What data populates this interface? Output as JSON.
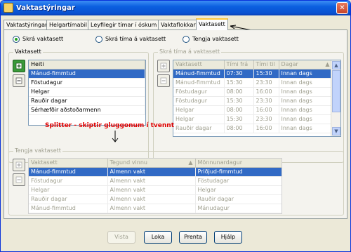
{
  "window": {
    "title": "Vaktastýringar"
  },
  "tabs": [
    {
      "label": "Vaktastýringar",
      "active": false
    },
    {
      "label": "Helgartímabil",
      "active": false
    },
    {
      "label": "Leyfilegir tímar í óskum",
      "active": false
    },
    {
      "label": "Vaktaflokkar",
      "active": false
    },
    {
      "label": "Vaktasett",
      "active": true
    }
  ],
  "radios": [
    {
      "label": "Skrá vaktasett",
      "checked": true
    },
    {
      "label": "Skrá tíma á vaktasett",
      "checked": false
    },
    {
      "label": "Tengja vaktasett",
      "checked": false
    }
  ],
  "vaktasett": {
    "legend": "Vaktasett",
    "header": "Heiti",
    "rows": [
      "Mánud-fimmtud",
      "Föstudagur",
      "Helgar",
      "Rauðir dagar",
      "Sérhæfðir aðstoðarmenn"
    ],
    "selected_index": 0
  },
  "timar": {
    "legend": "Skrá tíma á vaktasett",
    "columns": [
      "Vaktasett",
      "Tími frá",
      "Tími til",
      "Dagar"
    ],
    "rows": [
      [
        "Mánud-fimmtud",
        "07:30",
        "15:30",
        "Innan dags"
      ],
      [
        "Mánud-fimmtud",
        "15:30",
        "23:30",
        "Innan dags"
      ],
      [
        "Föstudagur",
        "08:00",
        "16:00",
        "Innan dags"
      ],
      [
        "Föstudagur",
        "15:30",
        "23:30",
        "Innan dags"
      ],
      [
        "Helgar",
        "08:00",
        "16:00",
        "Innan dags"
      ],
      [
        "Helgar",
        "15:30",
        "23:30",
        "Innan dags"
      ],
      [
        "Rauðir dagar",
        "08:00",
        "16:00",
        "Innan dags"
      ]
    ],
    "selected_index": 0
  },
  "annotation": "Splitter - skiptir gluggonum í tvennt",
  "tengja": {
    "legend": "Tengja vaktasett",
    "columns": [
      "Vaktasett",
      "Tegund vinnu",
      "Mönnunardagur"
    ],
    "rows": [
      [
        "Mánud-fimmtud",
        "Almenn vakt",
        "Priðjud-fimmtud"
      ],
      [
        "Föstudagur",
        "Almenn vakt",
        "Föstudagar"
      ],
      [
        "Helgar",
        "Almenn vakt",
        "Helgar"
      ],
      [
        "Rauðir dagar",
        "Almenn vakt",
        "Rauðir dagar"
      ],
      [
        "Mánud-fimmtud",
        "Almenn vakt",
        "Mánudagur"
      ]
    ],
    "selected_index": 0
  },
  "footer": {
    "buttons": [
      {
        "label": "Vista",
        "disabled": true
      },
      {
        "label": "Loka",
        "disabled": false
      },
      {
        "label": "Prenta",
        "disabled": false
      },
      {
        "label": "Hjálp",
        "disabled": false
      }
    ]
  },
  "icons": [
    "app-icon",
    "close-icon",
    "add-icon",
    "remove-icon",
    "sort-asc-icon",
    "scroll-up-icon",
    "scroll-down-icon"
  ],
  "colors": {
    "selection": "#316ac5",
    "title_bar": "#0a52d1",
    "annotation": "#e00000",
    "active_tab_accent": "#ffc83c"
  }
}
